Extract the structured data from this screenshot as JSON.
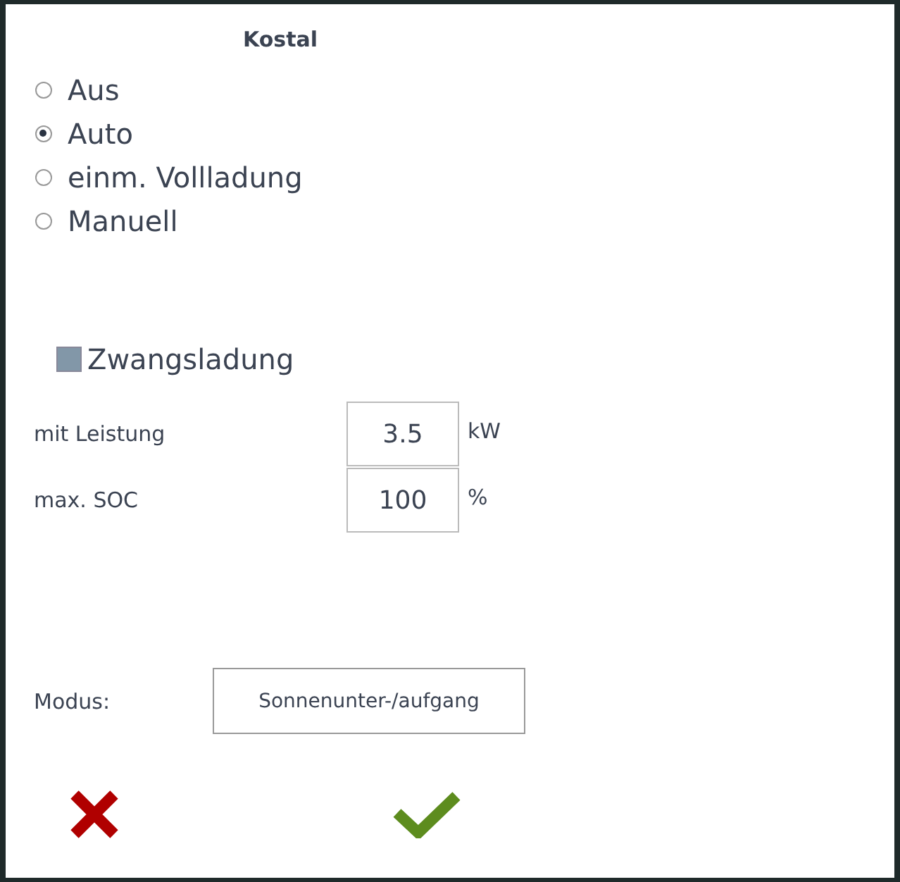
{
  "title": "Kostal",
  "modes": [
    {
      "label": "Aus",
      "selected": false
    },
    {
      "label": "Auto",
      "selected": true
    },
    {
      "label": "einm. Vollladung",
      "selected": false
    },
    {
      "label": "Manuell",
      "selected": false
    }
  ],
  "forced_charge": {
    "label": "Zwangsladung",
    "checked": true
  },
  "fields": [
    {
      "label": "mit Leistung",
      "value": "3.5",
      "unit": "kW"
    },
    {
      "label": "max. SOC",
      "value": "100",
      "unit": "%"
    }
  ],
  "mode": {
    "label": "Modus:",
    "value": "Sonnenunter-/aufgang"
  },
  "buttons": [
    {
      "kind": "cancel"
    },
    {
      "kind": "confirm"
    }
  ]
}
